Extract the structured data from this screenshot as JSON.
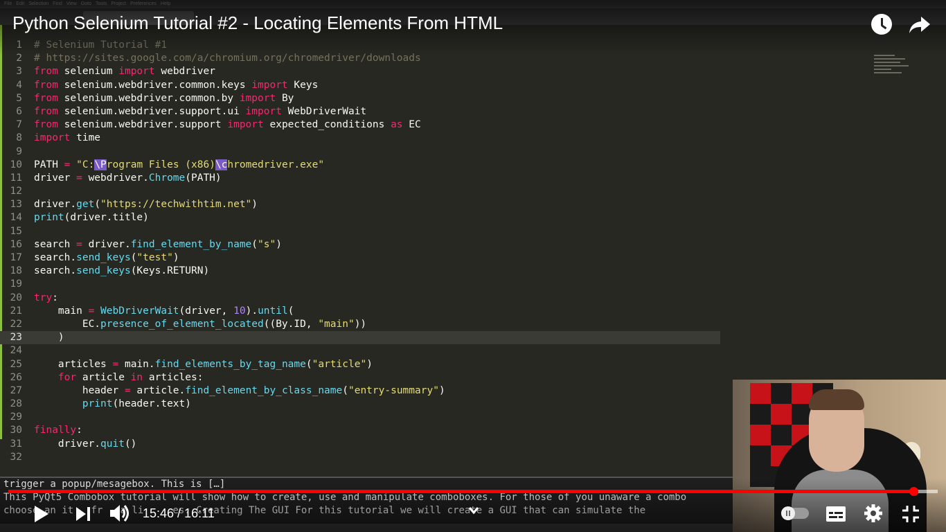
{
  "video": {
    "title": "Python Selenium Tutorial #2 - Locating Elements From HTML",
    "current_time": "15:46",
    "separator": " / ",
    "duration": "16:11",
    "progress_fraction": 0.974
  },
  "editor": {
    "menu": [
      "File",
      "Edit",
      "Selection",
      "Find",
      "View",
      "Goto",
      "Tools",
      "Project",
      "Preferences",
      "Help"
    ],
    "current_line": 23,
    "lines": [
      {
        "n": "1",
        "code": [
          {
            "t": "# Selenium Tutorial #1",
            "c": "cm"
          }
        ]
      },
      {
        "n": "2",
        "code": [
          {
            "t": "# https://sites.google.com/a/chromium.org/chromedriver/downloads",
            "c": "cm"
          }
        ]
      },
      {
        "n": "3",
        "code": [
          {
            "t": "from",
            "c": "kw"
          },
          {
            "t": " selenium "
          },
          {
            "t": "import",
            "c": "kw"
          },
          {
            "t": " webdriver"
          }
        ]
      },
      {
        "n": "4",
        "code": [
          {
            "t": "from",
            "c": "kw"
          },
          {
            "t": " selenium.webdriver.common.keys "
          },
          {
            "t": "import",
            "c": "kw"
          },
          {
            "t": " Keys"
          }
        ]
      },
      {
        "n": "5",
        "code": [
          {
            "t": "from",
            "c": "kw"
          },
          {
            "t": " selenium.webdriver.common.by "
          },
          {
            "t": "import",
            "c": "kw"
          },
          {
            "t": " By"
          }
        ]
      },
      {
        "n": "6",
        "code": [
          {
            "t": "from",
            "c": "kw"
          },
          {
            "t": " selenium.webdriver.support.ui "
          },
          {
            "t": "import",
            "c": "kw"
          },
          {
            "t": " WebDriverWait"
          }
        ]
      },
      {
        "n": "7",
        "code": [
          {
            "t": "from",
            "c": "kw"
          },
          {
            "t": " selenium.webdriver.support "
          },
          {
            "t": "import",
            "c": "kw"
          },
          {
            "t": " expected_conditions "
          },
          {
            "t": "as",
            "c": "kw"
          },
          {
            "t": " EC"
          }
        ]
      },
      {
        "n": "8",
        "code": [
          {
            "t": "import",
            "c": "kw"
          },
          {
            "t": " time"
          }
        ]
      },
      {
        "n": "9",
        "code": []
      },
      {
        "n": "10",
        "code": [
          {
            "t": "PATH "
          },
          {
            "t": "=",
            "c": "kw"
          },
          {
            "t": " "
          },
          {
            "t": "\"C:",
            "c": "str"
          },
          {
            "t": "\\P",
            "c": "sel"
          },
          {
            "t": "rogram Files (x86)",
            "c": "str"
          },
          {
            "t": "\\c",
            "c": "sel"
          },
          {
            "t": "hromedriver.exe\"",
            "c": "str"
          }
        ]
      },
      {
        "n": "11",
        "code": [
          {
            "t": "driver "
          },
          {
            "t": "=",
            "c": "kw"
          },
          {
            "t": " webdriver."
          },
          {
            "t": "Chrome",
            "c": "fn"
          },
          {
            "t": "(PATH)"
          }
        ]
      },
      {
        "n": "12",
        "code": []
      },
      {
        "n": "13",
        "code": [
          {
            "t": "driver."
          },
          {
            "t": "get",
            "c": "fn"
          },
          {
            "t": "("
          },
          {
            "t": "\"https://techwithtim.net\"",
            "c": "str"
          },
          {
            "t": ")"
          }
        ]
      },
      {
        "n": "14",
        "code": [
          {
            "t": "print",
            "c": "fn"
          },
          {
            "t": "(driver.title)"
          }
        ]
      },
      {
        "n": "15",
        "code": []
      },
      {
        "n": "16",
        "code": [
          {
            "t": "search "
          },
          {
            "t": "=",
            "c": "kw"
          },
          {
            "t": " driver."
          },
          {
            "t": "find_element_by_name",
            "c": "fn"
          },
          {
            "t": "("
          },
          {
            "t": "\"s\"",
            "c": "str"
          },
          {
            "t": ")"
          }
        ]
      },
      {
        "n": "17",
        "code": [
          {
            "t": "search."
          },
          {
            "t": "send_keys",
            "c": "fn"
          },
          {
            "t": "("
          },
          {
            "t": "\"test\"",
            "c": "str"
          },
          {
            "t": ")"
          }
        ]
      },
      {
        "n": "18",
        "code": [
          {
            "t": "search."
          },
          {
            "t": "send_keys",
            "c": "fn"
          },
          {
            "t": "(Keys.RETURN)"
          }
        ]
      },
      {
        "n": "19",
        "code": []
      },
      {
        "n": "20",
        "code": [
          {
            "t": "try",
            "c": "kw"
          },
          {
            "t": ":"
          }
        ]
      },
      {
        "n": "21",
        "code": [
          {
            "t": "    main "
          },
          {
            "t": "=",
            "c": "kw"
          },
          {
            "t": " "
          },
          {
            "t": "WebDriverWait",
            "c": "fn"
          },
          {
            "t": "(driver, "
          },
          {
            "t": "10",
            "c": "num"
          },
          {
            "t": ")."
          },
          {
            "t": "until",
            "c": "fn"
          },
          {
            "t": "("
          }
        ]
      },
      {
        "n": "22",
        "code": [
          {
            "t": "        EC."
          },
          {
            "t": "presence_of_element_located",
            "c": "fn"
          },
          {
            "t": "((By.ID, "
          },
          {
            "t": "\"main\"",
            "c": "str"
          },
          {
            "t": "))"
          }
        ]
      },
      {
        "n": "23",
        "code": [
          {
            "t": "    )"
          }
        ]
      },
      {
        "n": "24",
        "code": []
      },
      {
        "n": "25",
        "code": [
          {
            "t": "    articles "
          },
          {
            "t": "=",
            "c": "kw"
          },
          {
            "t": " main."
          },
          {
            "t": "find_elements_by_tag_name",
            "c": "fn"
          },
          {
            "t": "("
          },
          {
            "t": "\"article\"",
            "c": "str"
          },
          {
            "t": ")"
          }
        ]
      },
      {
        "n": "26",
        "code": [
          {
            "t": "    "
          },
          {
            "t": "for",
            "c": "kw"
          },
          {
            "t": " article "
          },
          {
            "t": "in",
            "c": "kw"
          },
          {
            "t": " articles:"
          }
        ]
      },
      {
        "n": "27",
        "code": [
          {
            "t": "        header "
          },
          {
            "t": "=",
            "c": "kw"
          },
          {
            "t": " article."
          },
          {
            "t": "find_element_by_class_name",
            "c": "fn"
          },
          {
            "t": "("
          },
          {
            "t": "\"entry-summary\"",
            "c": "str"
          },
          {
            "t": ")"
          }
        ]
      },
      {
        "n": "28",
        "code": [
          {
            "t": "        "
          },
          {
            "t": "print",
            "c": "fn"
          },
          {
            "t": "(header.text)"
          }
        ]
      },
      {
        "n": "29",
        "code": []
      },
      {
        "n": "30",
        "code": [
          {
            "t": "finally",
            "c": "kw"
          },
          {
            "t": ":"
          }
        ]
      },
      {
        "n": "31",
        "code": [
          {
            "t": "    driver."
          },
          {
            "t": "quit",
            "c": "fn"
          },
          {
            "t": "()"
          }
        ]
      },
      {
        "n": "32",
        "code": []
      }
    ]
  },
  "console": {
    "lines": [
      "trigger a popup/mesagebox. This is […]",
      "This PyQt5 Combobox tutorial will show how to create, use and manipulate comboboxes. For those of you unaware a combo",
      "choose an it   fr   a li     es. Creating The GUI For this tutorial we will create a GUI that can simulate the"
    ]
  },
  "colors": {
    "progress_played": "#ff0000",
    "editor_bg": "#272822",
    "keyword": "#f92672",
    "string": "#e6db74",
    "function": "#66d9ef"
  },
  "icons": [
    "watch-later-icon",
    "share-icon",
    "play-icon",
    "next-icon",
    "volume-icon",
    "chevron-down-icon",
    "autoplay-toggle",
    "captions-icon",
    "settings-gear-icon",
    "exit-fullscreen-icon"
  ]
}
